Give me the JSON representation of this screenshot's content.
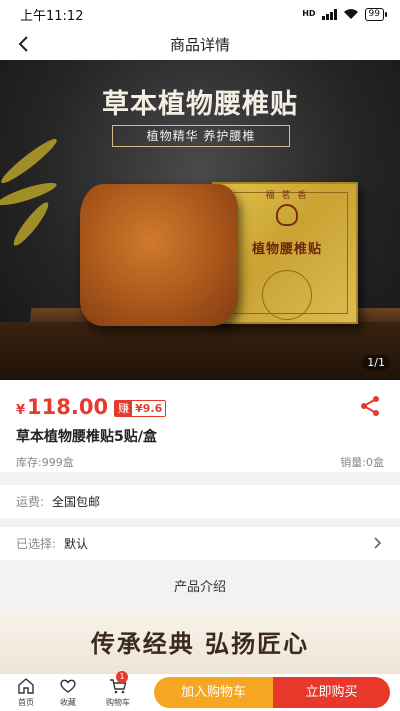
{
  "status_bar": {
    "time": "上午11:12",
    "network": "HD",
    "battery": "99"
  },
  "nav": {
    "title": "商品详情"
  },
  "gallery": {
    "headline": "草本植物腰椎贴",
    "subline": "植物精华  养护腰椎",
    "box_brand": "福 茗 香",
    "box_title": "植物腰椎贴",
    "pager": "1/1"
  },
  "product": {
    "currency": "¥",
    "price": "118.00",
    "earn_tag": "赚",
    "earn_value": "¥9.6",
    "name": "草本植物腰椎贴5贴/盒",
    "stock": "库存:999盒",
    "sales": "销量:0盒"
  },
  "shipping": {
    "label": "运费:",
    "value": "全国包邮"
  },
  "spec": {
    "label": "已选择:",
    "value": "默认"
  },
  "section": {
    "title": "产品介绍"
  },
  "detail": {
    "banner_text": "传承经典  弘扬匠心"
  },
  "bottom": {
    "home": "首页",
    "favorite": "收藏",
    "cart": "购物车",
    "cart_count": "1",
    "add_to_cart": "加入购物车",
    "buy_now": "立即购买"
  },
  "colors": {
    "accent_red": "#e63a2e",
    "accent_orange": "#f5a623"
  }
}
